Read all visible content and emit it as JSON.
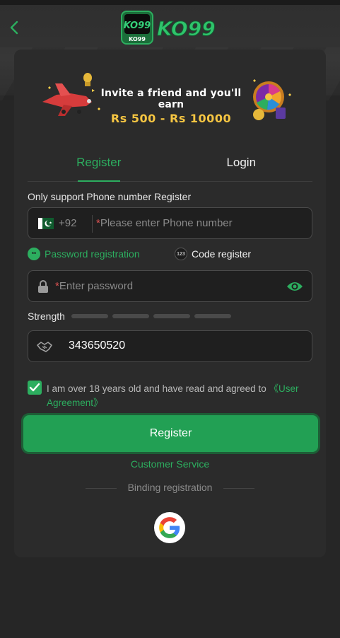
{
  "header": {
    "back_icon": "chevron-left-icon",
    "logo_badge_text": "KO99",
    "logo_badge_sub": "KO99",
    "logo_wordmark": "KO99"
  },
  "banner": {
    "line1": "Invite a friend and you'll earn",
    "line2": "Rs 500 - Rs 10000"
  },
  "tabs": [
    {
      "label": "Register",
      "active": true
    },
    {
      "label": "Login",
      "active": false
    }
  ],
  "form": {
    "support_note": "Only support Phone number Register",
    "phone": {
      "country_flag": "pakistan-flag-icon",
      "dial_code": "+92",
      "required_mark": "*",
      "placeholder": "Please enter Phone number"
    },
    "options": {
      "password_label": "Password registration",
      "password_icon_text": "**",
      "code_label": "Code register",
      "code_icon_text": "123"
    },
    "password": {
      "required_mark": "*",
      "placeholder": "Enter password"
    },
    "strength_label": "Strength",
    "invite_code": {
      "value": "343650520"
    },
    "agreement": {
      "checked": true,
      "text": "I am over 18 years old and have read and agreed to ",
      "link": "《User Agreement》"
    },
    "register_button": "Register",
    "customer_service": "Customer Service",
    "binding_label": "Binding registration"
  },
  "colors": {
    "accent": "#2cae5f",
    "button": "#22a054",
    "background": "#262626",
    "card": "#2b2b2b",
    "gold": "#f5c542",
    "required": "#e05353"
  }
}
